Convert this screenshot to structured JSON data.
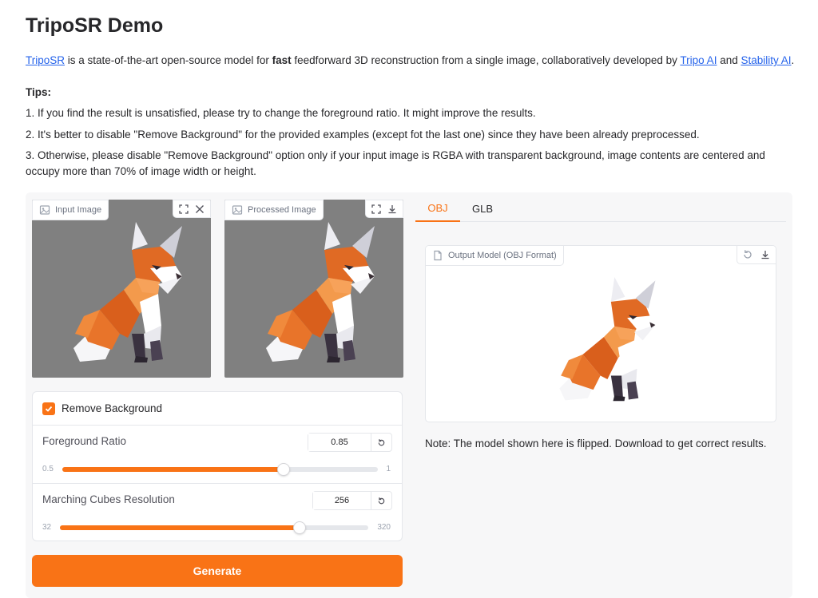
{
  "page": {
    "title": "TripoSR Demo",
    "intro": {
      "link_triposr": "TripoSR",
      "text_1": " is a state-of-the-art open-source model for ",
      "bold": "fast",
      "text_2": " feedforward 3D reconstruction from a single image, collaboratively developed by ",
      "link_tripo": "Tripo AI",
      "text_3": " and ",
      "link_stability": "Stability AI",
      "text_4": "."
    },
    "tips_heading": "Tips:",
    "tips": [
      "1. If you find the result is unsatisfied, please try to change the foreground ratio. It might improve the results.",
      "2. It's better to disable \"Remove Background\" for the provided examples (except fot the last one) since they have been already preprocessed.",
      "3. Otherwise, please disable \"Remove Background\" option only if your input image is RGBA with transparent background, image contents are centered and occupy more than 70% of image width or height."
    ]
  },
  "input_image": {
    "label": "Input Image",
    "icons": [
      "image-icon",
      "fullscreen-icon",
      "close-icon"
    ]
  },
  "processed_image": {
    "label": "Processed Image",
    "icons": [
      "image-icon",
      "fullscreen-icon",
      "download-icon"
    ]
  },
  "controls": {
    "remove_background": {
      "label": "Remove Background",
      "checked": true
    },
    "foreground_ratio": {
      "label": "Foreground Ratio",
      "value": "0.85",
      "min": "0.5",
      "max": "1",
      "fraction": 0.7
    },
    "marching_cubes": {
      "label": "Marching Cubes Resolution",
      "value": "256",
      "min": "32",
      "max": "320",
      "fraction": 0.778
    }
  },
  "generate_button": "Generate",
  "output": {
    "tabs": [
      {
        "label": "OBJ",
        "active": true
      },
      {
        "label": "GLB",
        "active": false
      }
    ],
    "model_label": "Output Model (OBJ Format)",
    "icons": [
      "file-icon",
      "undo-icon",
      "download-icon"
    ],
    "note": "Note: The model shown here is flipped. Download to get correct results."
  },
  "colors": {
    "accent": "#f97316",
    "link": "#2563eb",
    "image_bg": "#808080"
  }
}
